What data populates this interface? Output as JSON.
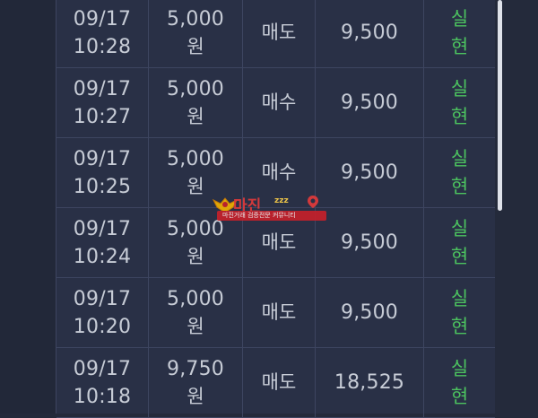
{
  "rows": [
    {
      "date": "09/17",
      "time": "10:28",
      "amount": "5,000",
      "unit": "원",
      "type": "매도",
      "price": "9,500",
      "status_top": "실",
      "status_bottom": "현"
    },
    {
      "date": "09/17",
      "time": "10:27",
      "amount": "5,000",
      "unit": "원",
      "type": "매수",
      "price": "9,500",
      "status_top": "실",
      "status_bottom": "현"
    },
    {
      "date": "09/17",
      "time": "10:25",
      "amount": "5,000",
      "unit": "원",
      "type": "매수",
      "price": "9,500",
      "status_top": "실",
      "status_bottom": "현"
    },
    {
      "date": "09/17",
      "time": "10:24",
      "amount": "5,000",
      "unit": "원",
      "type": "매도",
      "price": "9,500",
      "status_top": "실",
      "status_bottom": "현"
    },
    {
      "date": "09/17",
      "time": "10:20",
      "amount": "5,000",
      "unit": "원",
      "type": "매도",
      "price": "9,500",
      "status_top": "실",
      "status_bottom": "현"
    },
    {
      "date": "09/17",
      "time": "10:18",
      "amount": "9,750",
      "unit": "원",
      "type": "매도",
      "price": "18,525",
      "status_top": "실",
      "status_bottom": "현"
    }
  ],
  "watermark": {
    "title": "마진",
    "subtitle": "zzz",
    "tagline": "마진거래 검증전문 커뮤니티"
  },
  "colors": {
    "background": "#242a3b",
    "table": "#293046",
    "status_green": "#4cc25f",
    "watermark_red": "#e63a3a"
  }
}
